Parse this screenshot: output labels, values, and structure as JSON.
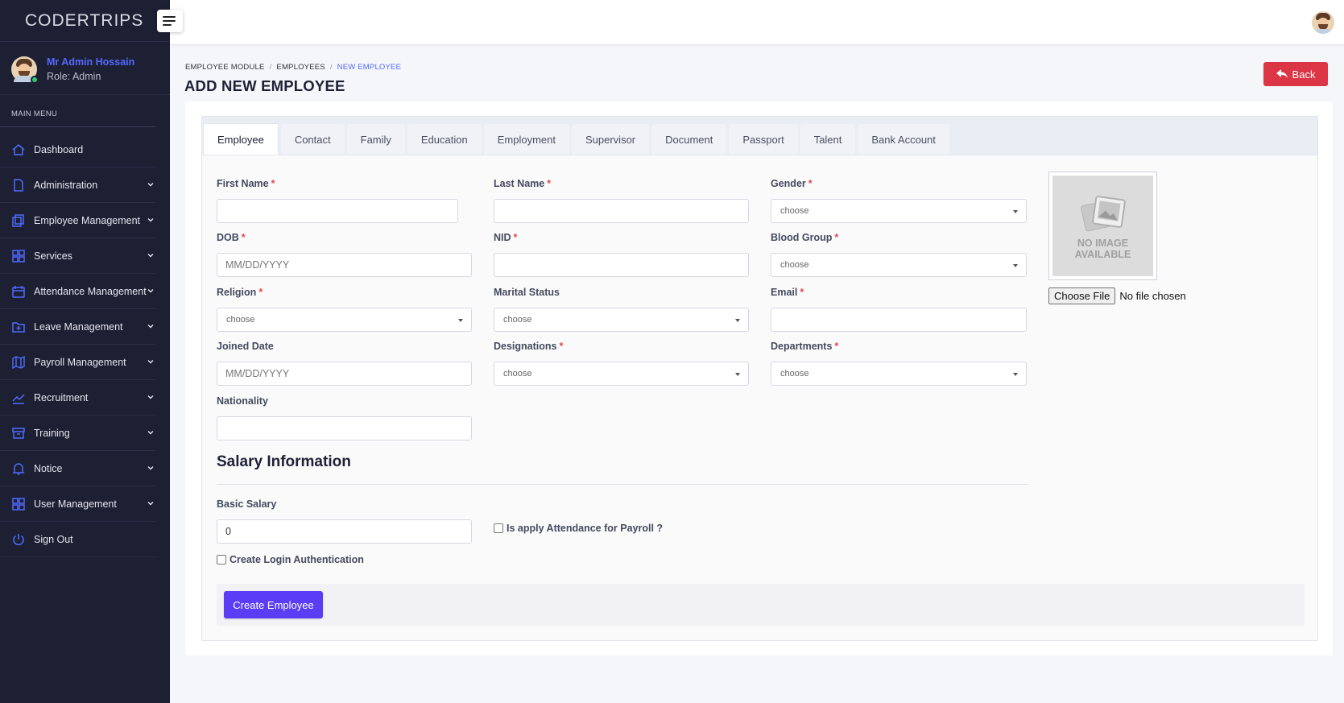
{
  "brand": "CODERTRIPS",
  "user": {
    "name": "Mr Admin Hossain",
    "role": "Role: Admin"
  },
  "sidebar": {
    "menu_title": "MAIN MENU",
    "items": [
      {
        "label": "Dashboard",
        "icon": "home-icon",
        "has_children": false
      },
      {
        "label": "Administration",
        "icon": "document-icon",
        "has_children": true
      },
      {
        "label": "Employee Management",
        "icon": "layers-icon",
        "has_children": true
      },
      {
        "label": "Services",
        "icon": "grid-icon",
        "has_children": true
      },
      {
        "label": "Attendance Management",
        "icon": "calendar-icon",
        "has_children": true
      },
      {
        "label": "Leave Management",
        "icon": "folder-plus-icon",
        "has_children": true
      },
      {
        "label": "Payroll Management",
        "icon": "map-icon",
        "has_children": true
      },
      {
        "label": "Recruitment",
        "icon": "trend-icon",
        "has_children": true
      },
      {
        "label": "Training",
        "icon": "archive-icon",
        "has_children": true
      },
      {
        "label": "Notice",
        "icon": "bell-icon",
        "has_children": true
      },
      {
        "label": "User Management",
        "icon": "grid-icon",
        "has_children": true
      },
      {
        "label": "Sign Out",
        "icon": "power-icon",
        "has_children": false
      }
    ]
  },
  "breadcrumb": {
    "item1": "EMPLOYEE MODULE",
    "item2": "EMPLOYEES",
    "item3": "NEW EMPLOYEE",
    "separator": "/"
  },
  "page_title": "ADD NEW EMPLOYEE",
  "back_label": "Back",
  "tabs": [
    "Employee",
    "Contact",
    "Family",
    "Education",
    "Employment",
    "Supervisor",
    "Document",
    "Passport",
    "Talent",
    "Bank Account"
  ],
  "form": {
    "first_name": {
      "label": "First Name",
      "value": ""
    },
    "last_name": {
      "label": "Last Name",
      "value": ""
    },
    "gender": {
      "label": "Gender",
      "value": "choose"
    },
    "dob": {
      "label": "DOB",
      "placeholder": "MM/DD/YYYY"
    },
    "nid": {
      "label": "NID",
      "value": ""
    },
    "blood_group": {
      "label": "Blood Group",
      "value": "choose"
    },
    "religion": {
      "label": "Religion",
      "value": "choose"
    },
    "marital_status": {
      "label": "Marital Status",
      "value": "choose"
    },
    "email": {
      "label": "Email",
      "value": ""
    },
    "joined_date": {
      "label": "Joined Date",
      "placeholder": "MM/DD/YYYY"
    },
    "designations": {
      "label": "Designations",
      "value": "choose"
    },
    "departments": {
      "label": "Departments",
      "value": "choose"
    },
    "nationality": {
      "label": "Nationality",
      "value": ""
    },
    "required_mark": "*"
  },
  "image": {
    "no_image_line1": "NO IMAGE",
    "no_image_line2": "AVAILABLE",
    "choose_file": "Choose File",
    "no_file": "No file chosen"
  },
  "salary": {
    "title": "Salary Information",
    "basic_label": "Basic Salary",
    "basic_value": "0",
    "attendance_label": "Is apply Attendance for Payroll ?",
    "login_label": "Create Login Authentication"
  },
  "create_label": "Create Employee",
  "colors": {
    "sidebar_bg": "#1d1f33",
    "accent": "#5468ff",
    "primary_button": "#5b3df5",
    "danger": "#dc3545"
  }
}
